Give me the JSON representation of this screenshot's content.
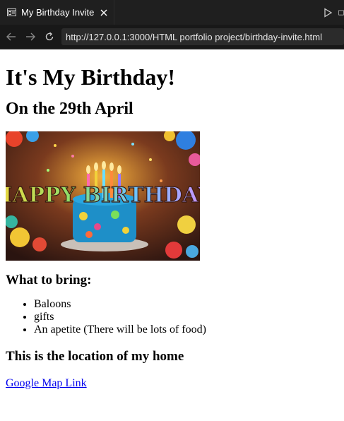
{
  "browser": {
    "tab_title": "My Birthday Invite",
    "url": "http://127.0.0.1:3000/HTML portfolio project/birthday-invite.html"
  },
  "page": {
    "heading": "It's My Birthday!",
    "date_heading": "On the 29th April",
    "banner_text": "HAPPY BIRTHDAY",
    "bring_heading": "What to bring:",
    "bring_items": [
      "Baloons",
      "gifts",
      "An apetite (There will be lots of food)"
    ],
    "location_heading": "This is the location of my home",
    "map_link": "Google Map Link"
  },
  "colors": {
    "chrome_bg": "#1f1f1f",
    "url_bg": "#2b2b2b",
    "link": "#0000ee"
  }
}
